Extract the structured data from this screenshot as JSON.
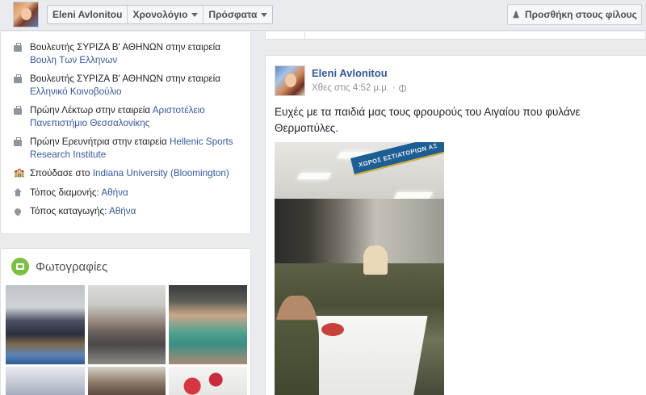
{
  "topbar": {
    "nav": [
      {
        "label": "Eleni Avlonitou",
        "caret": false
      },
      {
        "label": "Χρονολόγιο",
        "caret": true
      },
      {
        "label": "Πρόσφατα",
        "caret": true
      }
    ],
    "add_friend_label": "Προσθήκη στους φίλους"
  },
  "about": {
    "items": [
      {
        "icon": "briefcase-icon",
        "prefix": "Βουλευτής ΣΥΡΙΖΑ Β' ΑΘΗΝΩΝ στην εταιρεία ",
        "link": "Βουλη Των Ελληνων"
      },
      {
        "icon": "briefcase-icon",
        "prefix": "Βουλευτής ΣΥΡΙΖΑ Β' ΑΘΗΝΩΝ στην εταιρεία ",
        "link": "Ελληνικό Κοινοβούλιο"
      },
      {
        "icon": "briefcase-icon",
        "prefix": "Πρώην Λέκτωρ στην εταιρεία ",
        "link": "Αριστοτέλειο Πανεπιστήμιο Θεσσαλονίκης"
      },
      {
        "icon": "briefcase-icon",
        "prefix": "Πρώην Ερευνήτρια στην εταιρεία ",
        "link": "Hellenic Sports Research Institute"
      },
      {
        "icon": "school-icon",
        "prefix": "Σπούδασε στο ",
        "link": "Indiana University (Bloomington)"
      },
      {
        "icon": "home-icon",
        "prefix": "Τόπος διαμονής: ",
        "link": "Αθήνα"
      },
      {
        "icon": "location-pin-icon",
        "prefix": "Τόπος καταγωγής: ",
        "link": "Αθήνα"
      }
    ]
  },
  "photos": {
    "title": "Φωτογραφίες"
  },
  "post": {
    "author": "Eleni Avlonitou",
    "time": "Χθες στις 4:52 μ.μ.",
    "separator": "·",
    "privacy_icon": "globe-icon",
    "text": "Ευχές με τα παιδιά μας τους φρουρούς του Αιγαίου που φυλάνε Θερμοπύλες.",
    "photo_banner": "ΧΩΡΟΣ ΕΣΤΙΑΤΟΡΙΩΝ ΑΞ"
  }
}
